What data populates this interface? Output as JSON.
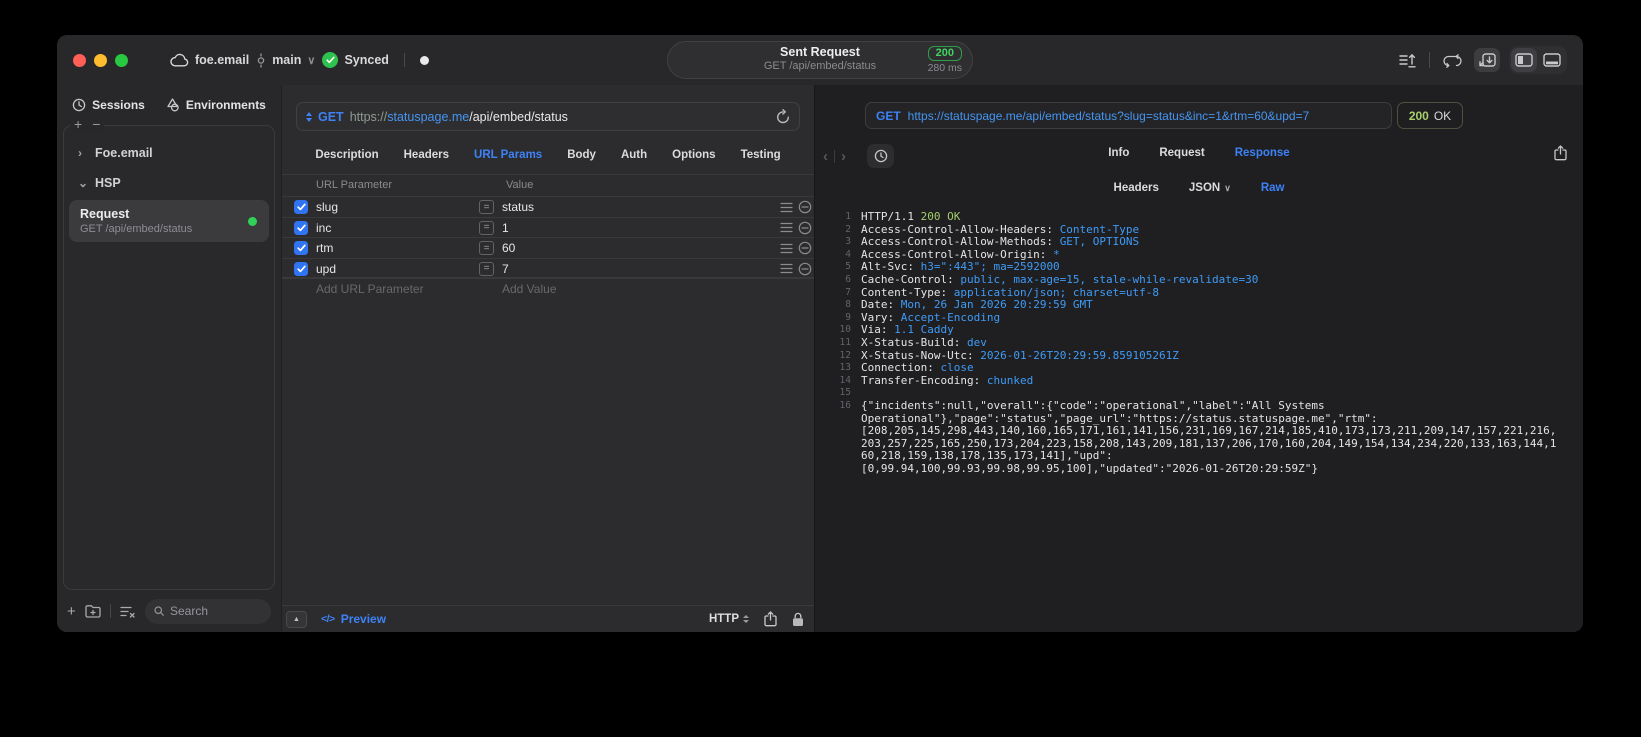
{
  "titlebar": {
    "project": "foe.email",
    "branch": "main",
    "sync_label": "Synced",
    "center": {
      "title": "Sent Request",
      "subtitle": "GET /api/embed/status",
      "status_code": "200",
      "duration": "280 ms"
    }
  },
  "sidebar": {
    "tabs": [
      {
        "label": "Sessions"
      },
      {
        "label": "Environments"
      }
    ],
    "groups": [
      {
        "label": "Foe.email",
        "expanded": false
      },
      {
        "label": "HSP",
        "expanded": true
      }
    ],
    "request": {
      "title": "Request",
      "subtitle": "GET /api/embed/status"
    },
    "search_placeholder": "Search"
  },
  "request_pane": {
    "method": "GET",
    "url": {
      "scheme": "https://",
      "host": "statuspage.me",
      "path": "/api/embed/status"
    },
    "tabs": [
      "Description",
      "Headers",
      "URL Params",
      "Body",
      "Auth",
      "Options",
      "Testing"
    ],
    "active_tab": "URL Params",
    "param_table": {
      "col_name": "URL Parameter",
      "col_value": "Value",
      "rows": [
        {
          "name": "slug",
          "value": "status",
          "checked": true
        },
        {
          "name": "inc",
          "value": "1",
          "checked": true
        },
        {
          "name": "rtm",
          "value": "60",
          "checked": true
        },
        {
          "name": "upd",
          "value": "7",
          "checked": true
        }
      ],
      "add_name": "Add URL Parameter",
      "add_value": "Add Value"
    },
    "footer": {
      "preview": "Preview",
      "protocol": "HTTP"
    }
  },
  "response_pane": {
    "method": "GET",
    "url": "https://statuspage.me/api/embed/status?slug=status&inc=1&rtm=60&upd=7",
    "status_code": "200",
    "status_text": "OK",
    "tabs": [
      "Info",
      "Request",
      "Response"
    ],
    "active_tab": "Response",
    "subtabs": [
      "Headers",
      "JSON",
      "Raw"
    ],
    "active_subtab": "Raw",
    "body": {
      "status_line": {
        "protocol": "HTTP/1.1",
        "status": "200 OK"
      },
      "headers": [
        {
          "name": "Access-Control-Allow-Headers",
          "value": "Content-Type"
        },
        {
          "name": "Access-Control-Allow-Methods",
          "value": "GET, OPTIONS"
        },
        {
          "name": "Access-Control-Allow-Origin",
          "value": "*"
        },
        {
          "name": "Alt-Svc",
          "value": "h3=\":443\"; ma=2592000"
        },
        {
          "name": "Cache-Control",
          "value": "public, max-age=15, stale-while-revalidate=30"
        },
        {
          "name": "Content-Type",
          "value": "application/json; charset=utf-8"
        },
        {
          "name": "Date",
          "value": "Mon, 26 Jan 2026 20:29:59 GMT"
        },
        {
          "name": "Vary",
          "value": "Accept-Encoding"
        },
        {
          "name": "Via",
          "value": "1.1 Caddy"
        },
        {
          "name": "X-Status-Build",
          "value": "dev"
        },
        {
          "name": "X-Status-Now-Utc",
          "value": "2026-01-26T20:29:59.859105261Z"
        },
        {
          "name": "Connection",
          "value": "close"
        },
        {
          "name": "Transfer-Encoding",
          "value": "chunked"
        }
      ],
      "json_lines": [
        "{\"incidents\":null,\"overall\":{\"code\":\"operational\",\"label\":\"All Systems",
        "Operational\"},\"page\":\"status\",\"page_url\":\"https://status.statuspage.me\",\"rtm\":",
        "[208,205,145,298,443,140,160,165,171,161,141,156,231,169,167,214,185,410,173,173,211,209,147,157,221,216,",
        "203,257,225,165,250,173,204,223,158,208,143,209,181,137,206,170,160,204,149,154,134,234,220,133,163,144,1",
        "60,218,159,138,178,135,173,141],\"upd\":",
        "[0,99.94,100,99.93,99.98,99.95,100],\"updated\":\"2026-01-26T20:29:59Z\"}"
      ]
    }
  },
  "icons": {
    "chevron_collapsed": "›",
    "chevron_expanded": "⌄",
    "branch_chevron": "∨",
    "json_chevron": "∨",
    "plus": "+",
    "minus": "−",
    "equals": "=",
    "triangle_up": "▲",
    "code": "</>",
    "back": "‹",
    "forward": "›"
  },
  "colors": {
    "accent_blue": "#3d82f7",
    "value_blue": "#3f9bf7",
    "green": "#30d158",
    "ok_green": "#a8cf6d"
  }
}
